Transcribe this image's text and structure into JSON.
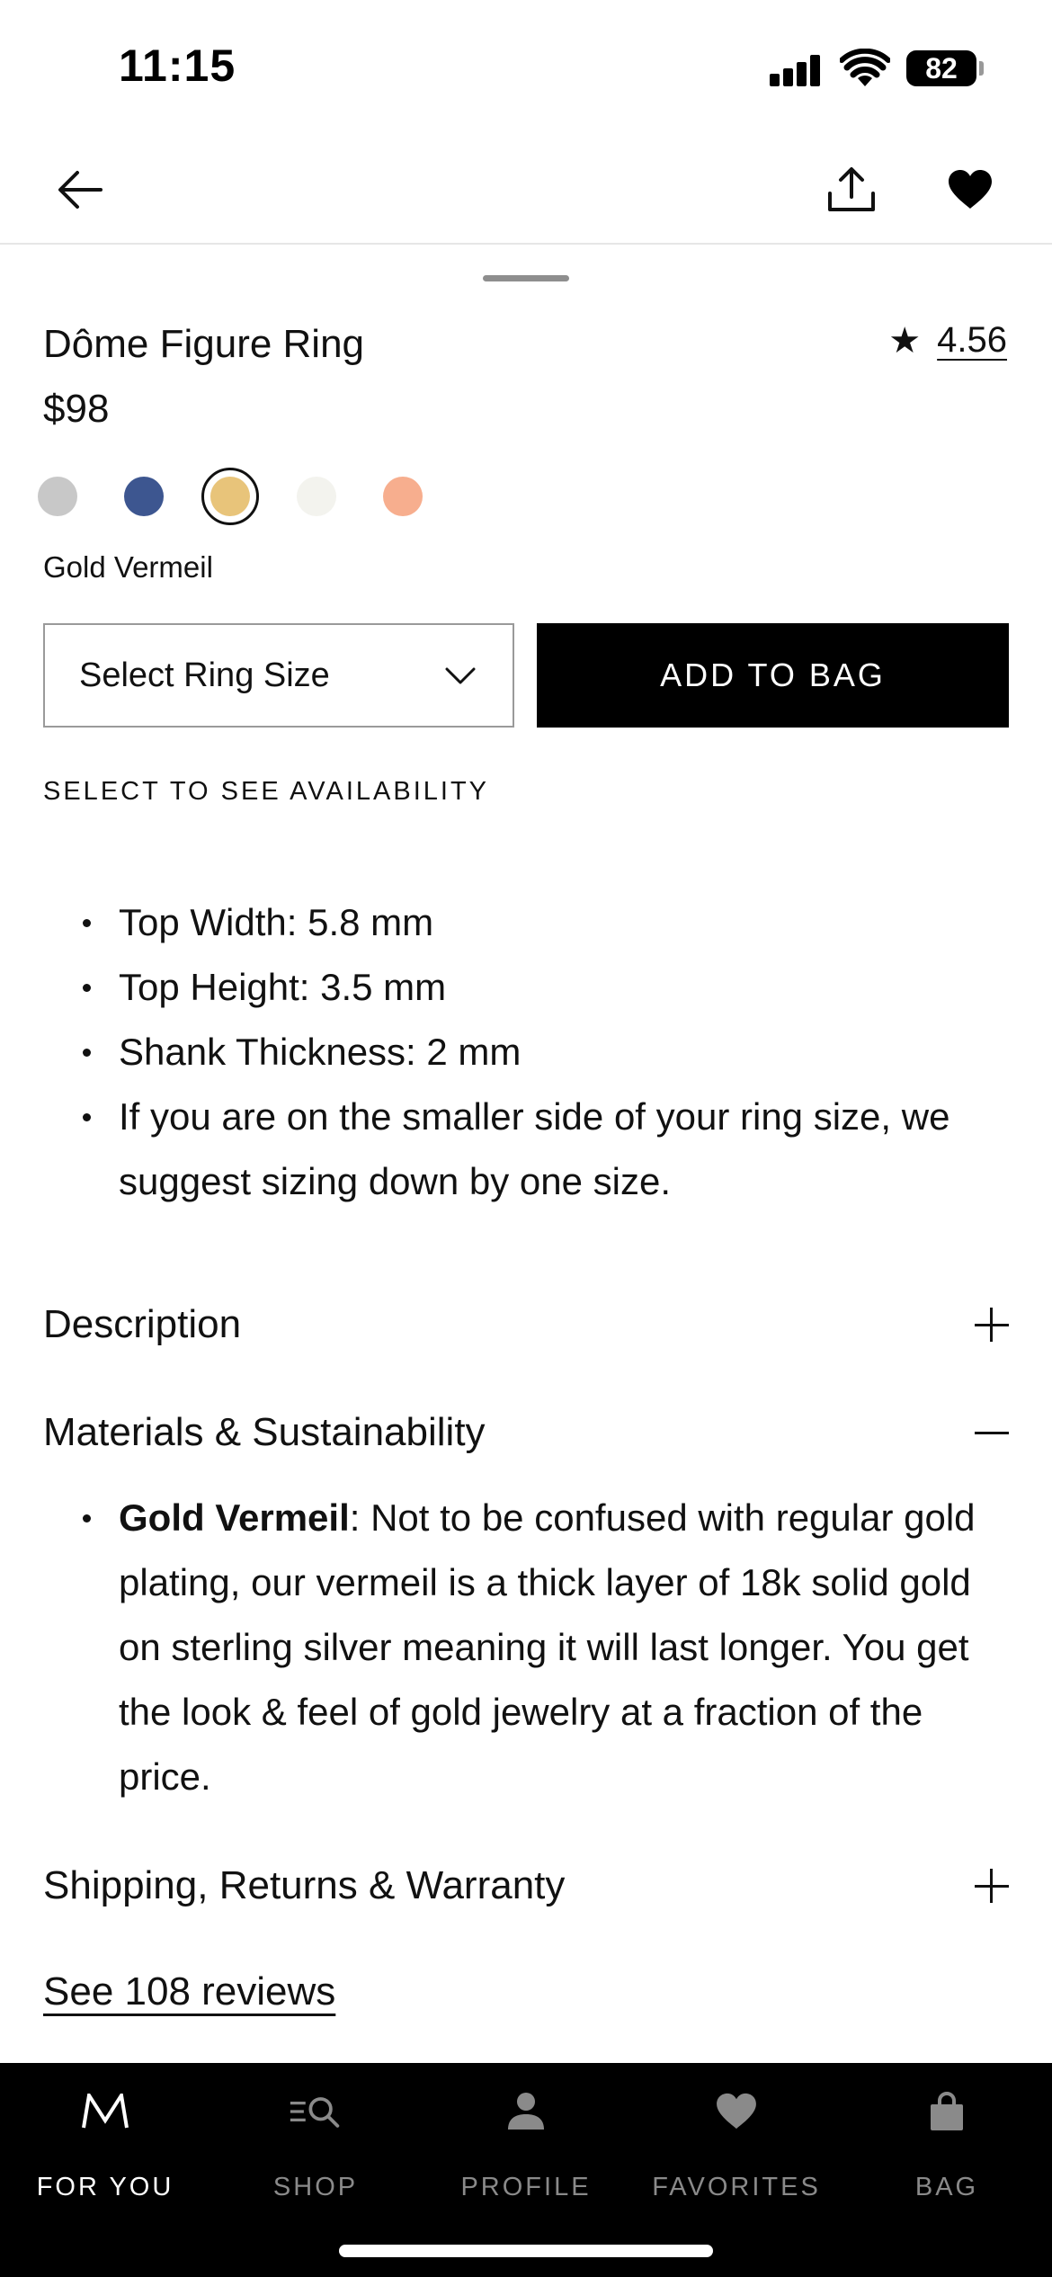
{
  "status_bar": {
    "time": "11:15",
    "battery": "82"
  },
  "header": {
    "back": "back-arrow-icon",
    "share": "share-icon",
    "favorite": "heart-icon"
  },
  "product": {
    "title": "Dôme Figure Ring",
    "price": "$98",
    "rating": "4.56",
    "selected_color": "Gold Vermeil",
    "swatches": [
      {
        "name": "silver",
        "color": "#c8c8c8"
      },
      {
        "name": "blue",
        "color": "#3d5690"
      },
      {
        "name": "gold",
        "color": "#e8c47a",
        "selected": true
      },
      {
        "name": "white",
        "color": "#f3f3ee"
      },
      {
        "name": "rose",
        "color": "#f7ae8e"
      }
    ]
  },
  "actions": {
    "size_select": "Select Ring Size",
    "add_to_bag": "ADD TO BAG",
    "availability": "SELECT TO SEE AVAILABILITY"
  },
  "specs": [
    "Top Width: 5.8 mm",
    "Top Height: 3.5 mm",
    "Shank Thickness: 2 mm",
    "If you are on the smaller side of your ring size, we suggest sizing down by one size."
  ],
  "accordions": {
    "description": {
      "title": "Description",
      "state": "collapsed"
    },
    "materials": {
      "title": "Materials & Sustainability",
      "state": "expanded",
      "item_bold": "Gold Vermeil",
      "item_text": ": Not to be confused with regular gold plating, our vermeil is a thick layer of 18k solid gold on sterling silver meaning it will last longer. You get the look & feel of gold jewelry at a fraction of the price."
    },
    "shipping": {
      "title": "Shipping, Returns & Warranty",
      "state": "collapsed"
    }
  },
  "reviews_link": "See 108 reviews",
  "tab_bar": {
    "tabs": [
      {
        "label": "FOR YOU",
        "icon": "m-logo-icon",
        "active": true
      },
      {
        "label": "SHOP",
        "icon": "search-menu-icon"
      },
      {
        "label": "PROFILE",
        "icon": "person-icon"
      },
      {
        "label": "FAVORITES",
        "icon": "heart-icon"
      },
      {
        "label": "BAG",
        "icon": "bag-icon"
      }
    ]
  }
}
